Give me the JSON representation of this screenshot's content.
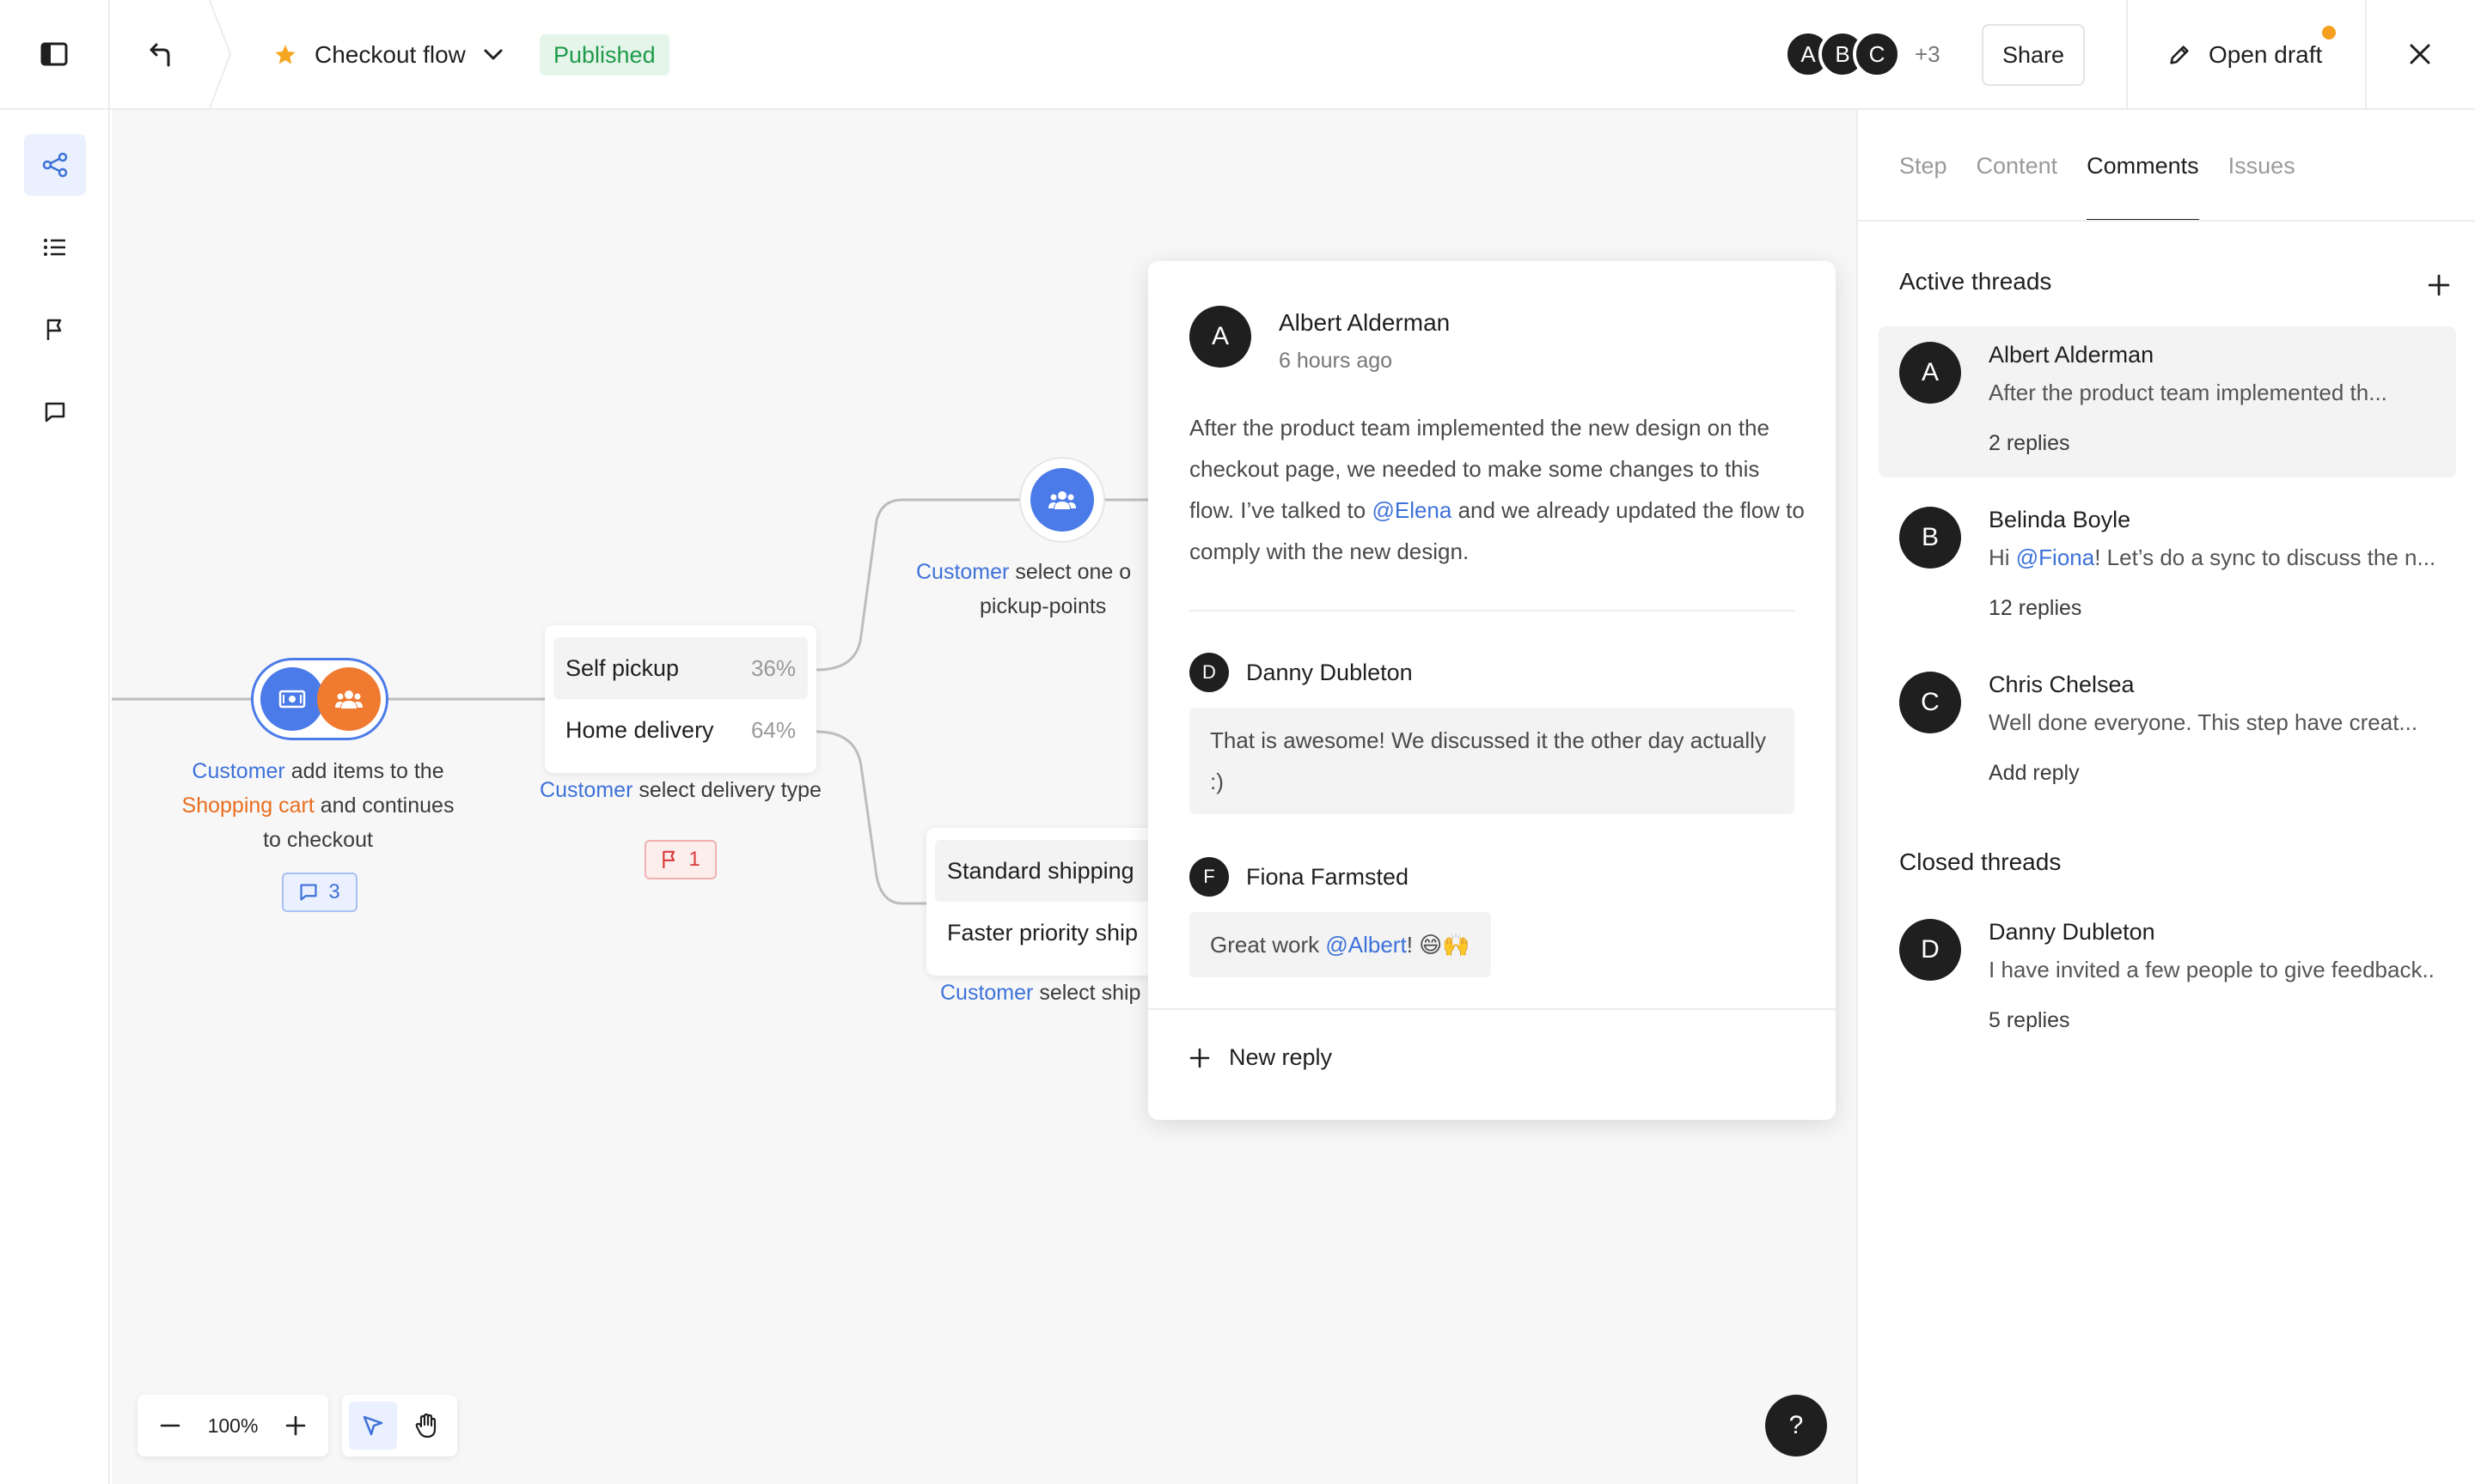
{
  "topbar": {
    "flow_title": "Checkout flow",
    "status": "Published",
    "collaborators": [
      "A",
      "B",
      "C"
    ],
    "collaborators_more": "+3",
    "share_label": "Share",
    "open_draft_label": "Open draft",
    "colors": {
      "published_bg": "#e6f5ea",
      "published_text": "#1e9a4a",
      "draft_dot": "#f5a020"
    }
  },
  "rail": {
    "items": [
      {
        "icon": "flow-diagram-icon",
        "active": true
      },
      {
        "icon": "list-icon",
        "active": false
      },
      {
        "icon": "flag-icon",
        "active": false
      },
      {
        "icon": "comment-icon",
        "active": false
      }
    ]
  },
  "canvas": {
    "colors": {
      "accent": "#4a7be8",
      "actor": "#3d72d9",
      "object": "#ea6d1e",
      "issue": "#d83b3b"
    },
    "node1": {
      "actor": "Customer",
      "text1": " add items to the",
      "object": "Shopping cart",
      "text2": " and continues",
      "text3": "to checkout",
      "comments_count": "3"
    },
    "node2": {
      "options": [
        {
          "label": "Self pickup",
          "pct": "36%"
        },
        {
          "label": "Home delivery",
          "pct": "64%"
        }
      ],
      "actor": "Customer",
      "text": " select delivery type",
      "issues_count": "1"
    },
    "node3": {
      "actor": "Customer",
      "text1": " select one o",
      "text2": "pickup-points"
    },
    "node4": {
      "options": [
        {
          "label": "Standard shipping"
        },
        {
          "label": "Faster priority ship"
        }
      ],
      "actor": "Customer",
      "text": " select ship"
    },
    "zoom": "100%",
    "help_label": "?"
  },
  "thread_popover": {
    "author_initial": "A",
    "author": "Albert Alderman",
    "time": "6 hours ago",
    "body_part1": "After the product team implemented the new design on the checkout page, we needed to make some changes to this flow. I’ve talked to ",
    "body_mention": "@Elena",
    "body_part2": " and we already updated the flow to comply with the new design.",
    "replies": [
      {
        "initial": "D",
        "author": "Danny Dubleton",
        "text": "That is awesome! We discussed it the other day actually :)"
      },
      {
        "initial": "F",
        "author": "Fiona Farmsted",
        "text_before": "Great work ",
        "mention": "@Albert",
        "text_after": "! 😄🙌"
      }
    ],
    "new_reply_label": "New reply"
  },
  "panel": {
    "tabs": [
      "Step",
      "Content",
      "Comments",
      "Issues"
    ],
    "active_tab": "Comments",
    "active_title": "Active threads",
    "closed_title": "Closed threads",
    "active_threads": [
      {
        "initial": "A",
        "name": "Albert Alderman",
        "preview": "After the product team implemented th...",
        "meta": "2 replies"
      },
      {
        "initial": "B",
        "name": "Belinda Boyle",
        "preview_before": "Hi ",
        "preview_mention": "@Fiona",
        "preview_after": "! Let’s do a sync to discuss the n...",
        "meta": "12 replies"
      },
      {
        "initial": "C",
        "name": "Chris Chelsea",
        "preview": "Well done everyone. This step have creat...",
        "meta": "Add reply"
      }
    ],
    "closed_threads": [
      {
        "initial": "D",
        "name": "Danny Dubleton",
        "preview": "I have invited a few people to give feedback...",
        "meta": "5 replies"
      }
    ]
  }
}
